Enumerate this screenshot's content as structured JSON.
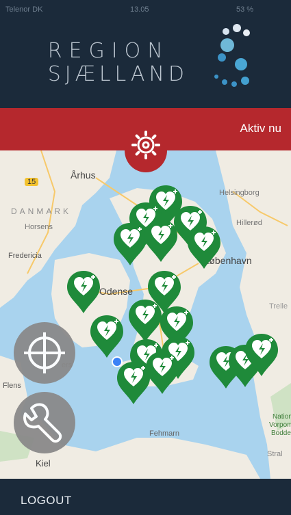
{
  "status_bar": {
    "carrier": "Telenor DK",
    "time": "13.05",
    "battery": "53 %"
  },
  "header": {
    "brand_line1": "REGION",
    "brand_line2": "SJÆLLAND"
  },
  "banner": {
    "status_text": "Aktiv nu"
  },
  "map": {
    "labels": {
      "aarhus": "Århus",
      "road": "15",
      "danmark": "DANMARK",
      "horsens": "Horsens",
      "fredericia": "Fredericia",
      "odense": "Odense",
      "helsingborg": "Helsingborg",
      "hillerod": "Hillerød",
      "kobenhavn": "København",
      "trelleborg": "Trelle",
      "fehmarn": "Fehmarn",
      "kiel": "Kiel",
      "stralsund": "Stral",
      "flensburg": "Flens",
      "svendborg": "ers",
      "national": "Nation",
      "vorpommersche": "Vorpom",
      "bodden": "Bodden"
    },
    "marker_icon": "aed-heart-icon"
  },
  "buttons": {
    "locate_icon": "crosshair-icon",
    "settings_icon": "wrench-icon",
    "gear_icon": "gear-icon"
  },
  "footer": {
    "logout_label": "LOGOUT"
  }
}
